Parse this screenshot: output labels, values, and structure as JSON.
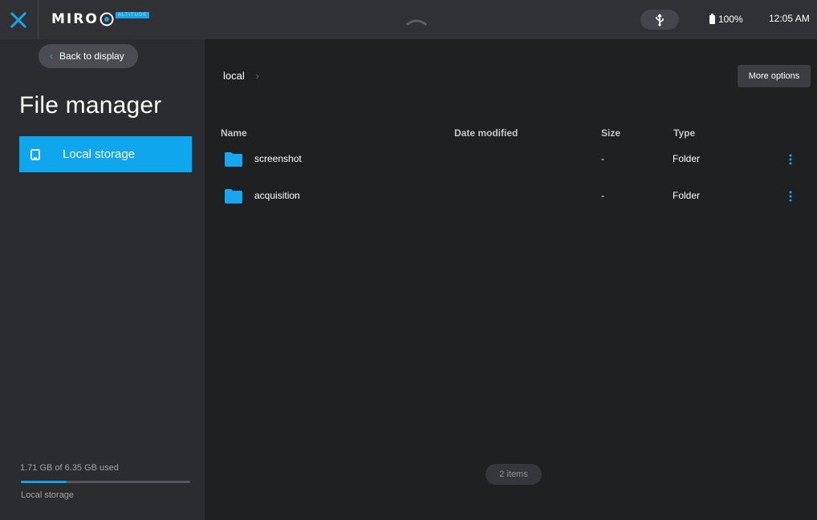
{
  "topbar": {
    "logo_text": "MIRO",
    "logo_badge": "ALTITUDE",
    "battery": "100%",
    "time": "12:05 AM",
    "accent_color": "#1aa3e8",
    "icons": [
      "close-icon",
      "chevron-up-icon",
      "usb-icon",
      "battery-icon"
    ]
  },
  "sidebar": {
    "back_label": "Back to display",
    "title": "File manager",
    "storage_item": {
      "label": "Local storage",
      "icon": "tablet-icon"
    },
    "usage": {
      "text": "1.71 GB of 6.35 GB used",
      "used_gb": 1.71,
      "total_gb": 6.35,
      "label": "Local storage"
    }
  },
  "main": {
    "breadcrumb": [
      "local"
    ],
    "more_options_label": "More options",
    "columns": {
      "name": "Name",
      "date": "Date modified",
      "size": "Size",
      "type": "Type"
    },
    "rows": [
      {
        "name": "screenshot",
        "date": "",
        "size": "-",
        "type": "Folder"
      },
      {
        "name": "acquisition",
        "date": "",
        "size": "-",
        "type": "Folder"
      }
    ],
    "items_count": "2 items"
  }
}
